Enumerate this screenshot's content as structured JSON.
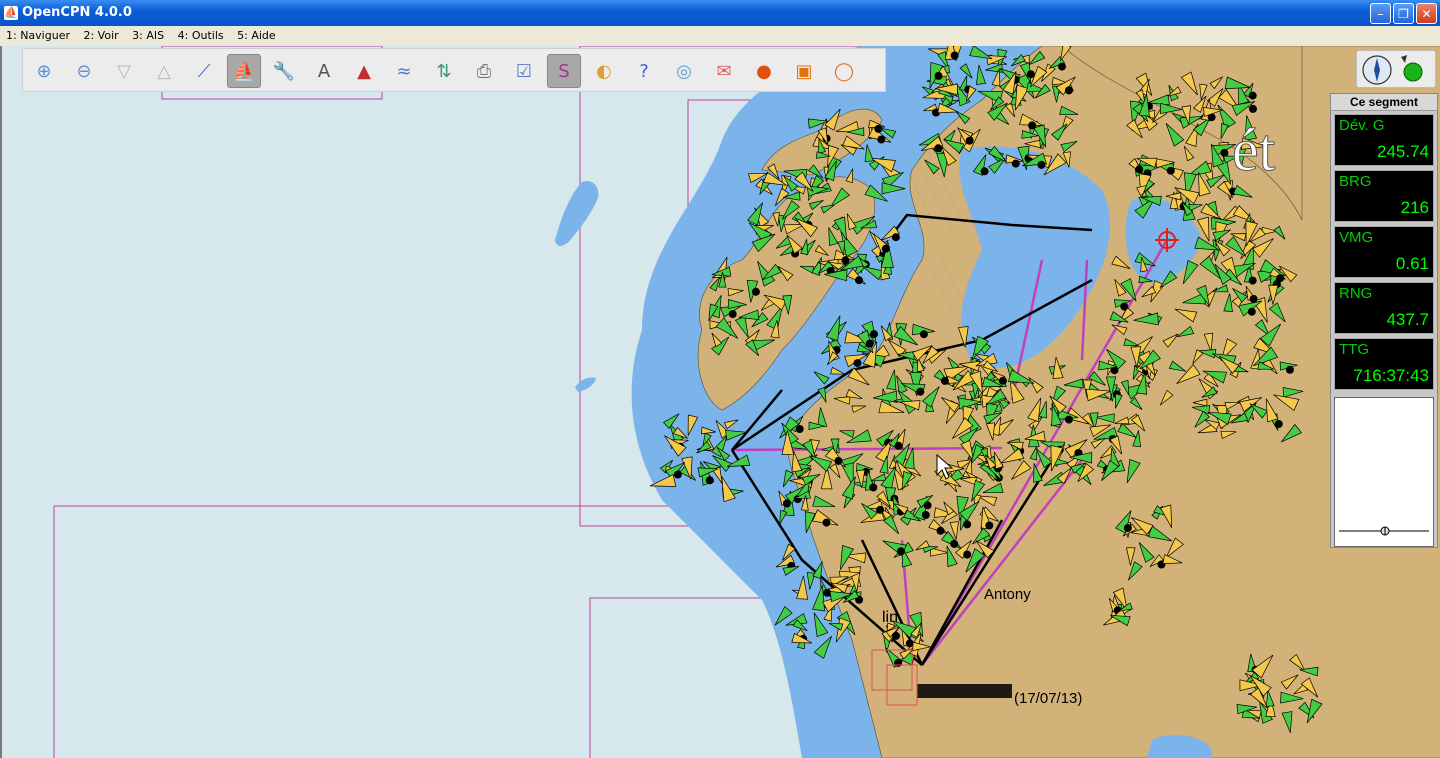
{
  "window": {
    "title": "OpenCPN 4.0.0",
    "icon": "opencpn-logo-icon",
    "minimize": "–",
    "restore": "❐",
    "close": "✕"
  },
  "menu": [
    "1: Naviguer",
    "2: Voir",
    "3: AIS",
    "4: Outils",
    "5: Aide"
  ],
  "toolbar": [
    {
      "name": "zoom-in",
      "icon": "magnifier-plus-icon",
      "glyph": "⊕"
    },
    {
      "name": "zoom-out",
      "icon": "magnifier-minus-icon",
      "glyph": "⊖"
    },
    {
      "name": "scale-down",
      "icon": "funnel-icon",
      "glyph": "▽"
    },
    {
      "name": "scale-up",
      "icon": "cone-icon",
      "glyph": "△"
    },
    {
      "name": "route",
      "icon": "route-icon",
      "glyph": "⟋"
    },
    {
      "name": "follow",
      "icon": "boat-icon",
      "glyph": "⛵",
      "active": true
    },
    {
      "name": "settings",
      "icon": "wrench-icon",
      "glyph": "🔧"
    },
    {
      "name": "text",
      "icon": "text-a-icon",
      "glyph": "A"
    },
    {
      "name": "ais",
      "icon": "ais-triangle-icon",
      "glyph": "▲"
    },
    {
      "name": "tide",
      "icon": "tide-icon",
      "glyph": "≈"
    },
    {
      "name": "current",
      "icon": "current-icon",
      "glyph": "⇅"
    },
    {
      "name": "print",
      "icon": "printer-icon",
      "glyph": "⎙"
    },
    {
      "name": "route-manager",
      "icon": "route-manager-icon",
      "glyph": "☑"
    },
    {
      "name": "track",
      "icon": "track-icon",
      "glyph": "S",
      "active": true
    },
    {
      "name": "color-scheme",
      "icon": "sunset-icon",
      "glyph": "◐"
    },
    {
      "name": "help",
      "icon": "help-icon",
      "glyph": "?"
    },
    {
      "name": "dashboard",
      "icon": "dashboard-icon",
      "glyph": "◎"
    },
    {
      "name": "grib",
      "icon": "grib-icon",
      "glyph": "✉"
    },
    {
      "name": "waypoint",
      "icon": "waypoint-icon",
      "glyph": "●"
    },
    {
      "name": "chart-download",
      "icon": "chart-download-icon",
      "glyph": "▣"
    },
    {
      "name": "mob",
      "icon": "lifebuoy-icon",
      "glyph": "◯"
    }
  ],
  "compass": {
    "icon": "compass-icon"
  },
  "route_panel": {
    "header": "Ce segment",
    "instruments": [
      {
        "label": "Dév.    G",
        "value": "245.74"
      },
      {
        "label": "BRG",
        "value": "216"
      },
      {
        "label": "VMG",
        "value": "0.61"
      },
      {
        "label": "RNG",
        "value": "437.7"
      },
      {
        "label": "TTG",
        "value": "716:37:43"
      }
    ]
  },
  "map_labels": {
    "antony": "Antony",
    "big_text": "ét",
    "lin": "lin",
    "cluster": "(17/07/13)"
  },
  "colors": {
    "deep_water": "#d6e8ec",
    "shallow_water": "#7ab4ea",
    "land": "#d2b279",
    "route_black": "#000000",
    "route_magenta": "#c040c0",
    "chart_border": "#c040a0",
    "ais_green": "#44cc44",
    "ais_yellow": "#f4c84a"
  }
}
